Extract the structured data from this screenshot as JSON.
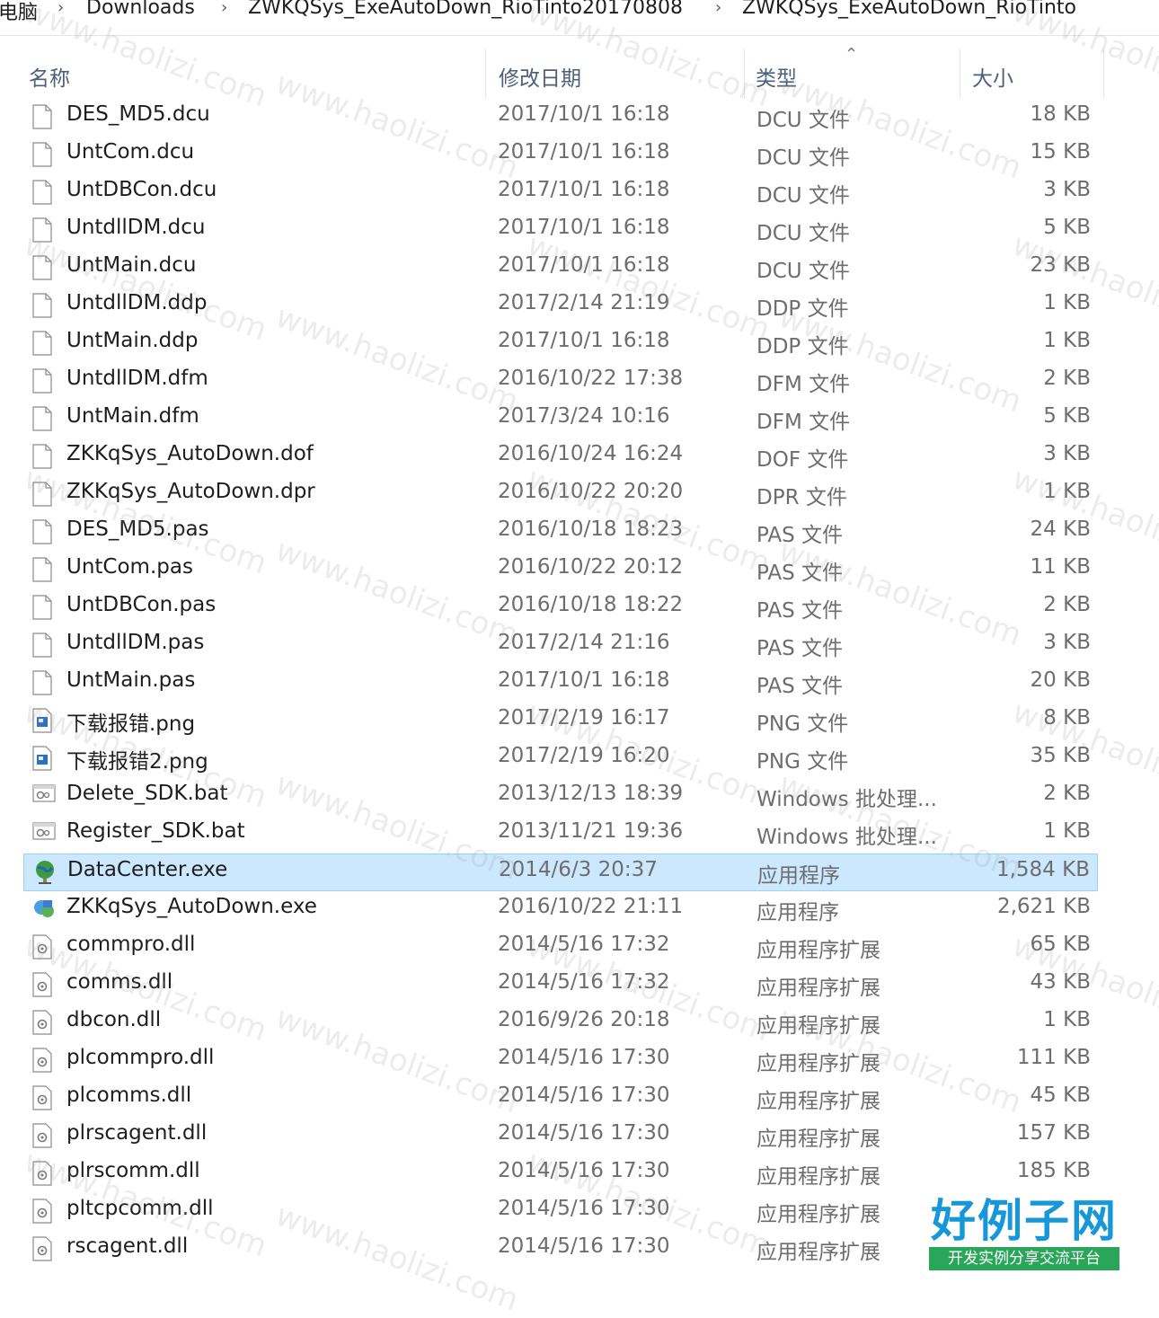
{
  "breadcrumb": {
    "items": [
      "电脑",
      "Downloads",
      "ZWKQSys_ExeAutoDown_RioTinto20170808",
      "ZWKQSys_ExeAutoDown_RioTinto"
    ]
  },
  "columns": {
    "name": "名称",
    "date": "修改日期",
    "type": "类型",
    "size": "大小"
  },
  "files": [
    {
      "name": "DES_MD5.dcu",
      "date": "2017/10/1 16:18",
      "type": "DCU 文件",
      "size": "18 KB",
      "icon": "blank-file-icon"
    },
    {
      "name": "UntCom.dcu",
      "date": "2017/10/1 16:18",
      "type": "DCU 文件",
      "size": "15 KB",
      "icon": "blank-file-icon"
    },
    {
      "name": "UntDBCon.dcu",
      "date": "2017/10/1 16:18",
      "type": "DCU 文件",
      "size": "3 KB",
      "icon": "blank-file-icon"
    },
    {
      "name": "UntdllDM.dcu",
      "date": "2017/10/1 16:18",
      "type": "DCU 文件",
      "size": "5 KB",
      "icon": "blank-file-icon"
    },
    {
      "name": "UntMain.dcu",
      "date": "2017/10/1 16:18",
      "type": "DCU 文件",
      "size": "23 KB",
      "icon": "blank-file-icon"
    },
    {
      "name": "UntdllDM.ddp",
      "date": "2017/2/14 21:19",
      "type": "DDP 文件",
      "size": "1 KB",
      "icon": "blank-file-icon"
    },
    {
      "name": "UntMain.ddp",
      "date": "2017/10/1 16:18",
      "type": "DDP 文件",
      "size": "1 KB",
      "icon": "blank-file-icon"
    },
    {
      "name": "UntdllDM.dfm",
      "date": "2016/10/22 17:38",
      "type": "DFM 文件",
      "size": "2 KB",
      "icon": "blank-file-icon"
    },
    {
      "name": "UntMain.dfm",
      "date": "2017/3/24 10:16",
      "type": "DFM 文件",
      "size": "5 KB",
      "icon": "blank-file-icon"
    },
    {
      "name": "ZKKqSys_AutoDown.dof",
      "date": "2016/10/24 16:24",
      "type": "DOF 文件",
      "size": "3 KB",
      "icon": "blank-file-icon"
    },
    {
      "name": "ZKKqSys_AutoDown.dpr",
      "date": "2016/10/22 20:20",
      "type": "DPR 文件",
      "size": "1 KB",
      "icon": "blank-file-icon"
    },
    {
      "name": "DES_MD5.pas",
      "date": "2016/10/18 18:23",
      "type": "PAS 文件",
      "size": "24 KB",
      "icon": "blank-file-icon"
    },
    {
      "name": "UntCom.pas",
      "date": "2016/10/22 20:12",
      "type": "PAS 文件",
      "size": "11 KB",
      "icon": "blank-file-icon"
    },
    {
      "name": "UntDBCon.pas",
      "date": "2016/10/18 18:22",
      "type": "PAS 文件",
      "size": "2 KB",
      "icon": "blank-file-icon"
    },
    {
      "name": "UntdllDM.pas",
      "date": "2017/2/14 21:16",
      "type": "PAS 文件",
      "size": "3 KB",
      "icon": "blank-file-icon"
    },
    {
      "name": "UntMain.pas",
      "date": "2017/10/1 16:18",
      "type": "PAS 文件",
      "size": "20 KB",
      "icon": "blank-file-icon"
    },
    {
      "name": "下载报错.png",
      "date": "2017/2/19 16:17",
      "type": "PNG 文件",
      "size": "8 KB",
      "icon": "image-file-icon"
    },
    {
      "name": "下载报错2.png",
      "date": "2017/2/19 16:20",
      "type": "PNG 文件",
      "size": "35 KB",
      "icon": "image-file-icon"
    },
    {
      "name": "Delete_SDK.bat",
      "date": "2013/12/13 18:39",
      "type": "Windows 批处理...",
      "size": "2 KB",
      "icon": "batch-file-icon"
    },
    {
      "name": "Register_SDK.bat",
      "date": "2013/11/21 19:36",
      "type": "Windows 批处理...",
      "size": "1 KB",
      "icon": "batch-file-icon"
    },
    {
      "name": "DataCenter.exe",
      "date": "2014/6/3 20:37",
      "type": "应用程序",
      "size": "1,584 KB",
      "icon": "globe-app-icon",
      "selected": true
    },
    {
      "name": "ZKKqSys_AutoDown.exe",
      "date": "2016/10/22 21:11",
      "type": "应用程序",
      "size": "2,621 KB",
      "icon": "app-exe-icon"
    },
    {
      "name": "commpro.dll",
      "date": "2014/5/16 17:32",
      "type": "应用程序扩展",
      "size": "65 KB",
      "icon": "dll-file-icon"
    },
    {
      "name": "comms.dll",
      "date": "2014/5/16 17:32",
      "type": "应用程序扩展",
      "size": "43 KB",
      "icon": "dll-file-icon"
    },
    {
      "name": "dbcon.dll",
      "date": "2016/9/26 20:18",
      "type": "应用程序扩展",
      "size": "1 KB",
      "icon": "dll-file-icon"
    },
    {
      "name": "plcommpro.dll",
      "date": "2014/5/16 17:30",
      "type": "应用程序扩展",
      "size": "111 KB",
      "icon": "dll-file-icon"
    },
    {
      "name": "plcomms.dll",
      "date": "2014/5/16 17:30",
      "type": "应用程序扩展",
      "size": "45 KB",
      "icon": "dll-file-icon"
    },
    {
      "name": "plrscagent.dll",
      "date": "2014/5/16 17:30",
      "type": "应用程序扩展",
      "size": "157 KB",
      "icon": "dll-file-icon"
    },
    {
      "name": "plrscomm.dll",
      "date": "2014/5/16 17:30",
      "type": "应用程序扩展",
      "size": "185 KB",
      "icon": "dll-file-icon"
    },
    {
      "name": "pltcpcomm.dll",
      "date": "2014/5/16 17:30",
      "type": "应用程序扩展",
      "size": "",
      "icon": "dll-file-icon"
    },
    {
      "name": "rscagent.dll",
      "date": "2014/5/16 17:30",
      "type": "应用程序扩展",
      "size": "",
      "icon": "dll-file-icon"
    }
  ],
  "watermark": {
    "text": "www.haolizi.com",
    "logo_main": "好例子网",
    "logo_sub": "开发实例分享交流平台"
  },
  "colors": {
    "selection_bg": "#cce8ff",
    "selection_border": "#99d1ff",
    "header_text": "#4c607a"
  }
}
